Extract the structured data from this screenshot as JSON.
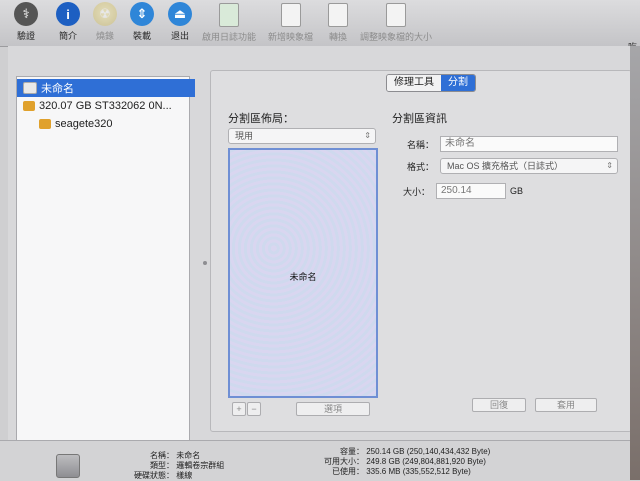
{
  "toolbar": {
    "items": [
      {
        "label": "驗證",
        "icon": "stethoscope-icon"
      },
      {
        "label": "簡介",
        "icon": "info-icon"
      },
      {
        "label": "燒錄",
        "icon": "burn-disc-icon"
      },
      {
        "label": "裝載",
        "icon": "mount-icon"
      },
      {
        "label": "退出",
        "icon": "eject-icon"
      },
      {
        "label": "啟用日誌功能",
        "icon": "journal-icon"
      },
      {
        "label": "新增映象檔",
        "icon": "new-image-icon"
      },
      {
        "label": "轉換",
        "icon": "convert-icon"
      },
      {
        "label": "調整映象檔的大小",
        "icon": "resize-image-icon"
      }
    ]
  },
  "sidebar": {
    "items": [
      {
        "label": "未命名",
        "selected": true
      },
      {
        "label": "320.07 GB ST332062 0N...",
        "selected": false
      },
      {
        "label": "seagete320",
        "selected": false
      }
    ]
  },
  "tabs": {
    "repair": "修理工具",
    "partition": "分割"
  },
  "layout_panel": {
    "title": "分割區佈局：",
    "scheme_value": "現用",
    "partition_name": "未命名",
    "options_button": "選項"
  },
  "info_panel": {
    "title": "分割區資訊",
    "name_label": "名稱：",
    "name_value": "未命名",
    "format_label": "格式：",
    "format_value": "Mac OS 擴充格式（日誌式）",
    "size_label": "大小：",
    "size_value": "250.14",
    "size_unit": "GB",
    "revert_button": "回復",
    "apply_button": "套用"
  },
  "bottom": {
    "name_label": "名稱：",
    "name_value": "未命名",
    "type_label": "類型：",
    "type_value": "邏輯卷宗群組",
    "status_label": "硬碟狀態：",
    "status_value": "樣線",
    "capacity_label": "容量：",
    "capacity_value": "250.14 GB (250,140,434,432 Byte)",
    "available_label": "可用大小：",
    "available_value": "249.8 GB (249,804,881,920 Byte)",
    "used_label": "已使用：",
    "used_value": "335.6 MB (335,552,512 Byte)"
  },
  "colors": {
    "accent": "#2f6fd6",
    "toolbar_bg": "#d0d0d3"
  }
}
